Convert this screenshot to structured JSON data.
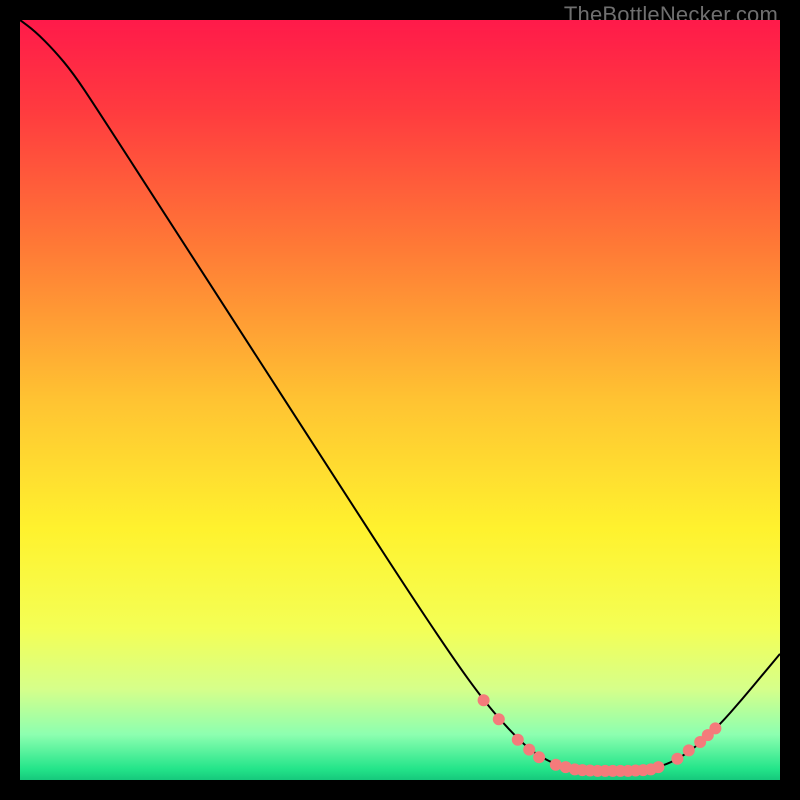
{
  "watermark": "TheBottleNecker.com",
  "chart_data": {
    "type": "line",
    "title": "",
    "xlabel": "",
    "ylabel": "",
    "xlim": [
      0,
      100
    ],
    "ylim": [
      0,
      100
    ],
    "background_gradient": {
      "stops": [
        {
          "offset": 0.0,
          "color": "#ff1a4a"
        },
        {
          "offset": 0.12,
          "color": "#ff3b3f"
        },
        {
          "offset": 0.3,
          "color": "#ff7a36"
        },
        {
          "offset": 0.5,
          "color": "#ffc332"
        },
        {
          "offset": 0.67,
          "color": "#fff22e"
        },
        {
          "offset": 0.8,
          "color": "#f4ff55"
        },
        {
          "offset": 0.88,
          "color": "#d6ff8a"
        },
        {
          "offset": 0.94,
          "color": "#8dffb0"
        },
        {
          "offset": 0.985,
          "color": "#24e58a"
        },
        {
          "offset": 1.0,
          "color": "#16c87c"
        }
      ]
    },
    "series": [
      {
        "name": "bottleneck-curve",
        "color": "#000000",
        "width": 2,
        "points": [
          {
            "x": 0.0,
            "y": 100.0
          },
          {
            "x": 2.0,
            "y": 98.5
          },
          {
            "x": 4.5,
            "y": 96.0
          },
          {
            "x": 7.0,
            "y": 93.0
          },
          {
            "x": 10.0,
            "y": 88.5
          },
          {
            "x": 20.0,
            "y": 73.0
          },
          {
            "x": 30.0,
            "y": 57.5
          },
          {
            "x": 40.0,
            "y": 42.0
          },
          {
            "x": 50.0,
            "y": 26.5
          },
          {
            "x": 57.0,
            "y": 16.0
          },
          {
            "x": 61.0,
            "y": 10.5
          },
          {
            "x": 64.0,
            "y": 7.0
          },
          {
            "x": 67.0,
            "y": 4.0
          },
          {
            "x": 70.0,
            "y": 2.2
          },
          {
            "x": 73.0,
            "y": 1.4
          },
          {
            "x": 76.0,
            "y": 1.2
          },
          {
            "x": 80.0,
            "y": 1.2
          },
          {
            "x": 83.0,
            "y": 1.4
          },
          {
            "x": 86.0,
            "y": 2.4
          },
          {
            "x": 89.0,
            "y": 4.4
          },
          {
            "x": 92.0,
            "y": 7.2
          },
          {
            "x": 95.0,
            "y": 10.6
          },
          {
            "x": 98.0,
            "y": 14.2
          },
          {
            "x": 100.0,
            "y": 16.6
          }
        ]
      }
    ],
    "markers": {
      "color": "#f47b7b",
      "radius": 6,
      "points": [
        {
          "x": 61.0,
          "y": 10.5
        },
        {
          "x": 63.0,
          "y": 8.0
        },
        {
          "x": 65.5,
          "y": 5.3
        },
        {
          "x": 67.0,
          "y": 4.0
        },
        {
          "x": 68.3,
          "y": 3.0
        },
        {
          "x": 70.5,
          "y": 2.0
        },
        {
          "x": 71.8,
          "y": 1.7
        },
        {
          "x": 73.0,
          "y": 1.4
        },
        {
          "x": 74.0,
          "y": 1.3
        },
        {
          "x": 75.0,
          "y": 1.25
        },
        {
          "x": 76.0,
          "y": 1.2
        },
        {
          "x": 77.0,
          "y": 1.2
        },
        {
          "x": 78.0,
          "y": 1.2
        },
        {
          "x": 79.0,
          "y": 1.2
        },
        {
          "x": 80.0,
          "y": 1.2
        },
        {
          "x": 81.0,
          "y": 1.25
        },
        {
          "x": 82.0,
          "y": 1.3
        },
        {
          "x": 83.0,
          "y": 1.4
        },
        {
          "x": 84.0,
          "y": 1.7
        },
        {
          "x": 86.5,
          "y": 2.8
        },
        {
          "x": 88.0,
          "y": 3.9
        },
        {
          "x": 89.5,
          "y": 5.0
        },
        {
          "x": 90.5,
          "y": 5.9
        },
        {
          "x": 91.5,
          "y": 6.8
        }
      ]
    }
  }
}
